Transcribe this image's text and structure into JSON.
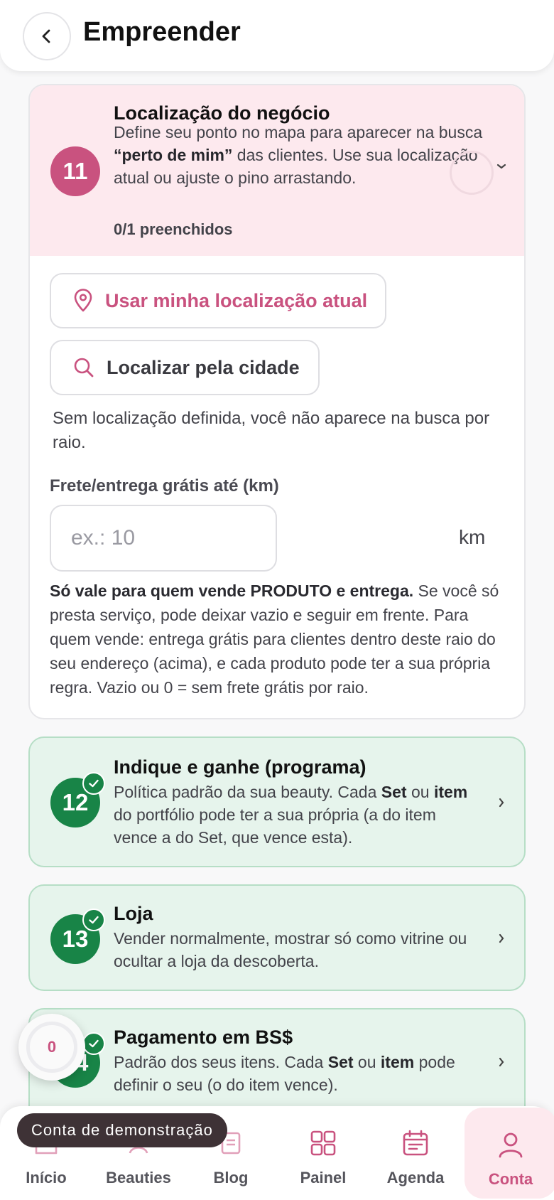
{
  "header": {
    "title": "Empreender"
  },
  "location_card": {
    "number": "11",
    "title": "Localização do negócio",
    "desc_part1": "Define seu ponto no mapa para aparecer na busca ",
    "desc_bold": "“perto de mim”",
    "desc_part2": " das clientes. Use sua localização atual ou ajuste o pino arrastando.",
    "filled": "0/1 preenchidos",
    "use_location_label": "Usar minha localização atual",
    "find_city_label": "Localizar pela cidade",
    "no_location_text": "Sem localização definida, você não aparece na busca por raio.",
    "freight_label": "Frete/entrega grátis até (km)",
    "freight_placeholder": "ex.: 10",
    "freight_value": "",
    "freight_unit": "km",
    "note_bold": "Só vale para quem vende PRODUTO e entrega.",
    "note_rest": " Se você só presta serviço, pode deixar vazio e seguir em frente. Para quem vende: entrega grátis para clientes dentro deste raio do seu endereço (acima), e cada produto pode ter a sua própria regra. Vazio ou 0 = sem frete grátis por raio."
  },
  "referral_card": {
    "number": "12",
    "title": "Indique e ganhe (programa)",
    "desc_1": "Política padrão da sua beauty. Cada ",
    "desc_b1": "Set",
    "desc_2": " ou ",
    "desc_b2": "item",
    "desc_3": " do portfólio pode ter a sua própria (a do item vence a do Set, que vence esta)."
  },
  "store_card": {
    "number": "13",
    "title": "Loja",
    "desc": "Vender normalmente, mostrar só como vitrine ou ocultar a loja da descoberta."
  },
  "payment_card": {
    "number": "14",
    "title": "Pagamento em BS$",
    "desc_1": "Padrão dos seus itens. Cada ",
    "desc_b1": "Set",
    "desc_2": " ou ",
    "desc_b2": "item",
    "desc_3": " pode definir o seu (o do item vence)."
  },
  "fab": {
    "count": "0"
  },
  "demo_pill": "Conta de demonstração",
  "nav": [
    {
      "label": "Início",
      "icon": "home-icon"
    },
    {
      "label": "Beauties",
      "icon": "beauties-icon"
    },
    {
      "label": "Blog",
      "icon": "blog-icon"
    },
    {
      "label": "Painel",
      "icon": "grid-icon"
    },
    {
      "label": "Agenda",
      "icon": "calendar-icon"
    },
    {
      "label": "Conta",
      "icon": "user-icon",
      "active": true
    }
  ],
  "colors": {
    "brand_pink": "#c9527f",
    "success_green": "#188447",
    "pink_bg": "#fde9ee",
    "green_bg": "#e6f4ec"
  }
}
